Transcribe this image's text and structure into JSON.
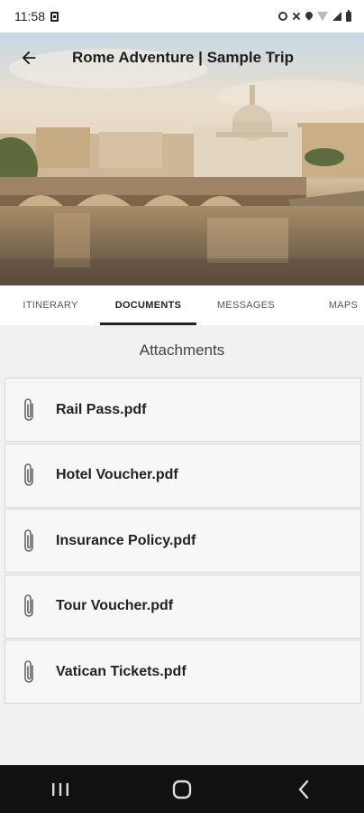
{
  "status_bar": {
    "time": "11:58",
    "icons": [
      "notification-square-icon",
      "alarm-icon",
      "mute-icon",
      "location-icon",
      "wifi-icon",
      "signal-icon",
      "battery-icon"
    ]
  },
  "header": {
    "title": "Rome Adventure | Sample Trip",
    "back_icon": "arrow-left-icon"
  },
  "tabs": [
    {
      "label": "ITINERARY",
      "active": false
    },
    {
      "label": "DOCUMENTS",
      "active": true
    },
    {
      "label": "MESSAGES",
      "active": false
    },
    {
      "label": "MAPS",
      "active": false
    }
  ],
  "documents": {
    "section_title": "Attachments",
    "item_icon": "paperclip-icon",
    "items": [
      {
        "name": "Rail Pass.pdf"
      },
      {
        "name": "Hotel Voucher.pdf"
      },
      {
        "name": "Insurance Policy.pdf"
      },
      {
        "name": "Tour Voucher.pdf"
      },
      {
        "name": "Vatican Tickets.pdf"
      }
    ]
  },
  "nav_bar": {
    "buttons": [
      "recents-icon",
      "home-icon",
      "back-icon"
    ]
  },
  "colors": {
    "tab_indicator": "#222222",
    "page_background": "#f1f1f1",
    "nav_bar_background": "#111111"
  }
}
